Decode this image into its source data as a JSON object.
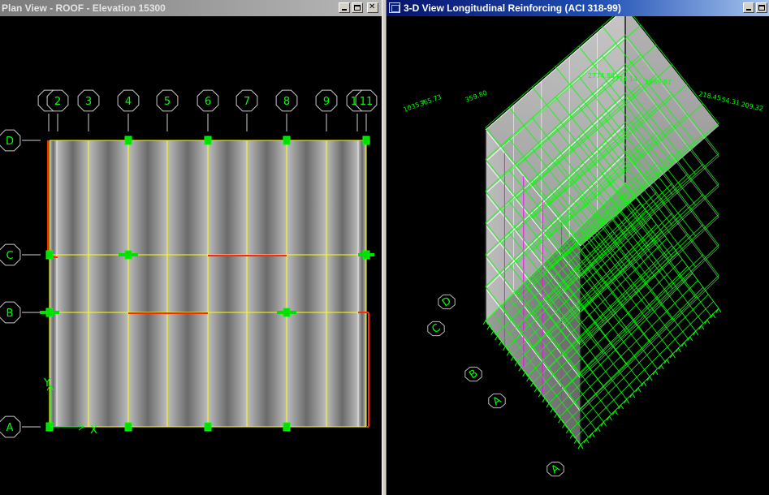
{
  "plan_view": {
    "title": "Plan View - ROOF - Elevation 15300",
    "grid_columns": [
      "1",
      "2",
      "3",
      "4",
      "5",
      "6",
      "7",
      "8",
      "9",
      "10",
      "11"
    ],
    "grid_rows": [
      "D",
      "C",
      "B",
      "A"
    ],
    "axis_x": "X",
    "axis_y": "Y"
  },
  "view_3d": {
    "title": "3-D View  Longitudinal Reinforcing  (ACI 318-99)",
    "rebar_values": [
      "1035.7",
      "365.73",
      "359.80",
      "2774.88",
      "2774.14",
      "1865.87",
      "218.45",
      "54.31",
      "209.32"
    ]
  },
  "window_buttons": {
    "minimize": "minimize",
    "maximize": "maximize",
    "close": "close"
  },
  "colors": {
    "grid": "#00ff00",
    "beam": "#ffff00",
    "reinforcing": "#ff2a00",
    "magenta": "#ff00ff",
    "background": "#000000"
  }
}
